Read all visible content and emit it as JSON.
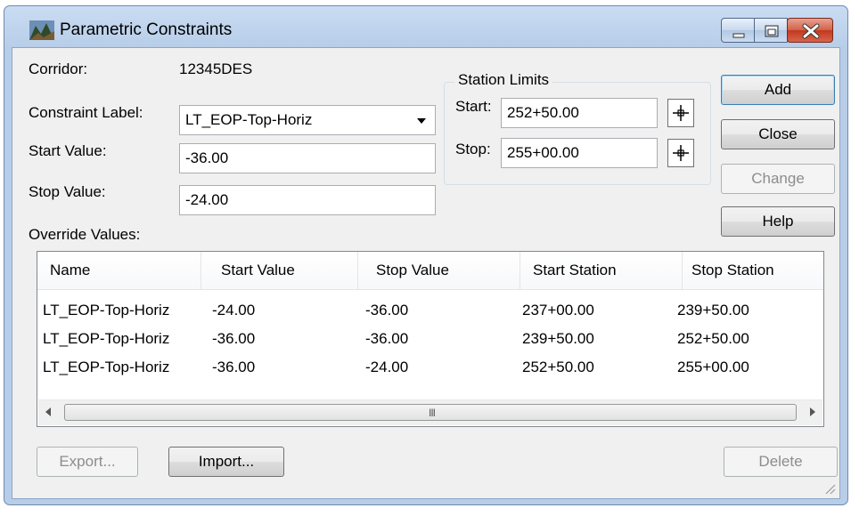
{
  "window": {
    "title": "Parametric Constraints"
  },
  "form": {
    "corridor_label": "Corridor:",
    "corridor_value": "12345DES",
    "constraint_label": "Constraint Label:",
    "constraint_value": "LT_EOP-Top-Horiz",
    "start_value_label": "Start Value:",
    "start_value": "-36.00",
    "stop_value_label": "Stop Value:",
    "stop_value": "-24.00",
    "override_label": "Override Values:"
  },
  "station_limits": {
    "title": "Station Limits",
    "start_label": "Start:",
    "start_value": "252+50.00",
    "stop_label": "Stop:",
    "stop_value": "255+00.00"
  },
  "buttons": {
    "add": "Add",
    "close": "Close",
    "change": "Change",
    "help": "Help",
    "export": "Export...",
    "import": "Import...",
    "delete": "Delete"
  },
  "table": {
    "columns": [
      "Name",
      "Start Value",
      "Stop Value",
      "Start Station",
      "Stop Station"
    ],
    "rows": [
      [
        "LT_EOP-Top-Horiz",
        "-24.00",
        "-36.00",
        "237+00.00",
        "239+50.00"
      ],
      [
        "LT_EOP-Top-Horiz",
        "-36.00",
        "-36.00",
        "239+50.00",
        "252+50.00"
      ],
      [
        "LT_EOP-Top-Horiz",
        "-36.00",
        "-24.00",
        "252+50.00",
        "255+00.00"
      ]
    ],
    "scroll_grip": "III"
  },
  "icons": {
    "app": "terrain-app-icon",
    "pick": "crosshair-pick-icon",
    "minimize": "minimize-icon",
    "maximize": "maximize-icon",
    "close": "close-icon"
  },
  "colors": {
    "close_button": "#c7442a",
    "default_button_border": "#3c7fb1"
  }
}
